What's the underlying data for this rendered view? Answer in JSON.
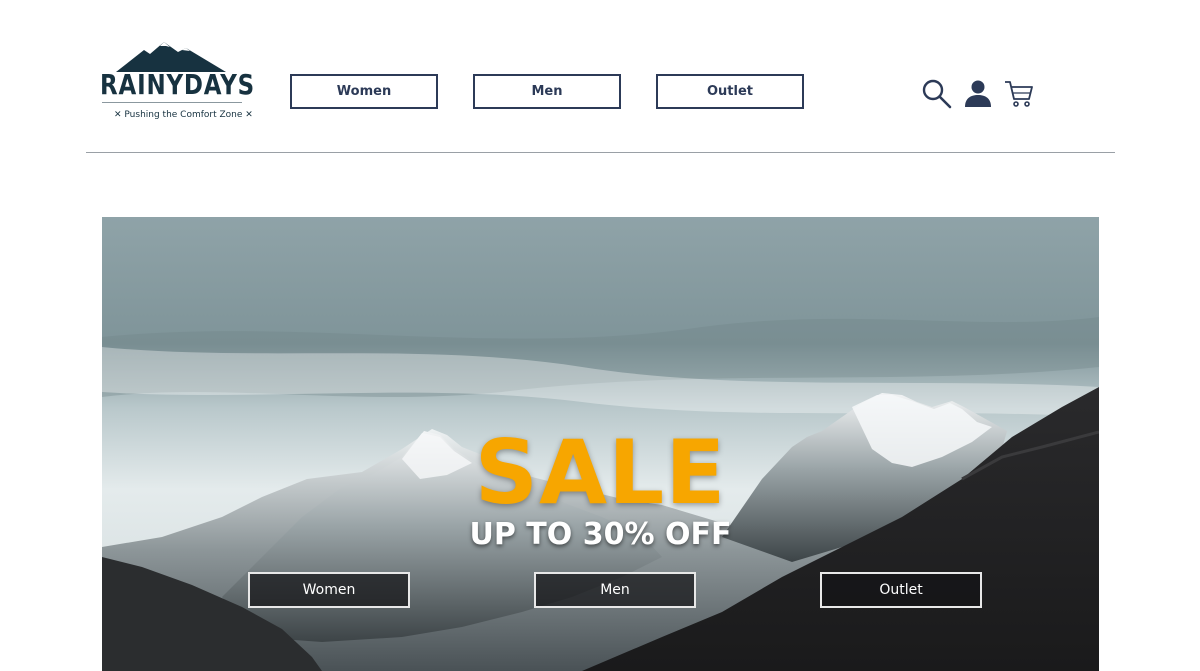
{
  "brand": {
    "name": "RAINYDAYS",
    "tagline": "✕ Pushing the Comfort Zone ✕",
    "color": "#173240"
  },
  "nav": {
    "items": [
      {
        "label": "Women"
      },
      {
        "label": "Men"
      },
      {
        "label": "Outlet"
      }
    ]
  },
  "header_icons": {
    "search": "search-icon",
    "account": "user-icon",
    "cart": "cart-icon"
  },
  "hero": {
    "title": "SALE",
    "subtitle": "UP TO 30% OFF",
    "title_color": "#f7a600",
    "buttons": [
      {
        "label": "Women"
      },
      {
        "label": "Men"
      },
      {
        "label": "Outlet"
      }
    ]
  },
  "colors": {
    "nav_border": "#2c3a57",
    "divider": "#9aa0a6"
  }
}
